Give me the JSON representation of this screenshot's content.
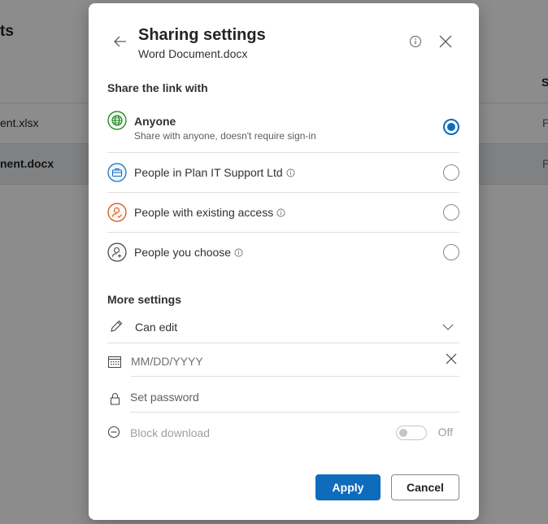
{
  "background": {
    "title_fragment": "ts",
    "column_fragment": "S",
    "rows": [
      {
        "name_fragment": "ent.xlsx",
        "tail_fragment": "P"
      },
      {
        "name_fragment": "nent.docx",
        "tail_fragment": "P"
      }
    ]
  },
  "dialog": {
    "title": "Sharing settings",
    "subtitle": "Word Document.docx",
    "icons": {
      "back": "arrow-left-icon",
      "info": "info-icon",
      "close": "close-icon"
    },
    "share_section": {
      "label": "Share the link with",
      "options": [
        {
          "label": "Anyone",
          "description": "Share with anyone, doesn't require sign-in",
          "icon": "globe-icon",
          "icon_color": "#107c10",
          "has_info": false,
          "selected": true
        },
        {
          "label": "People in Plan IT Support Ltd",
          "description": "",
          "icon": "briefcase-icon",
          "icon_color": "#0f6cbd",
          "has_info": true,
          "selected": false
        },
        {
          "label": "People with existing access",
          "description": "",
          "icon": "person-check-icon",
          "icon_color": "#ca5010",
          "has_info": true,
          "selected": false
        },
        {
          "label": "People you choose",
          "description": "",
          "icon": "person-add-icon",
          "icon_color": "#424242",
          "has_info": true,
          "selected": false
        }
      ]
    },
    "more_settings": {
      "label": "More settings",
      "permission": {
        "value": "Can edit",
        "icon": "pencil-icon"
      },
      "expiration": {
        "placeholder": "MM/DD/YYYY",
        "icon": "calendar-icon"
      },
      "password": {
        "placeholder": "Set password",
        "icon": "lock-icon"
      },
      "block_download": {
        "label": "Block download",
        "state": "Off",
        "enabled": false,
        "icon": "block-icon"
      }
    },
    "buttons": {
      "apply": "Apply",
      "cancel": "Cancel"
    }
  },
  "colors": {
    "accent": "#0f6cbd"
  }
}
